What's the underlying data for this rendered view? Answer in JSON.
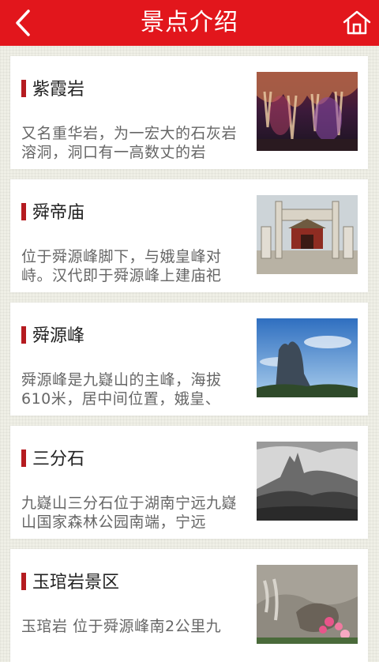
{
  "header": {
    "title": "景点介绍",
    "back_icon": "back-arrow-icon",
    "home_icon": "home-icon"
  },
  "colors": {
    "header_bg": "#e2161c",
    "accent_bar": "#b51b20"
  },
  "spots": [
    {
      "name": "紫霞岩",
      "desc": "又名重华岩，为一宏大的石灰岩溶洞，洞口有一高数丈的岩"
    },
    {
      "name": "舜帝庙",
      "desc": "位于舜源峰脚下，与娥皇峰对峙。汉代即于舜源峰上建庙祀"
    },
    {
      "name": "舜源峰",
      "desc": "舜源峰是九嶷山的主峰，海拔610米，居中间位置，娥皇、"
    },
    {
      "name": "三分石",
      "desc": "九嶷山三分石位于湖南宁远九嶷山国家森林公园南端，宁远"
    },
    {
      "name": "玉琯岩景区",
      "desc": "玉琯岩 位于舜源峰南2公里九"
    }
  ]
}
